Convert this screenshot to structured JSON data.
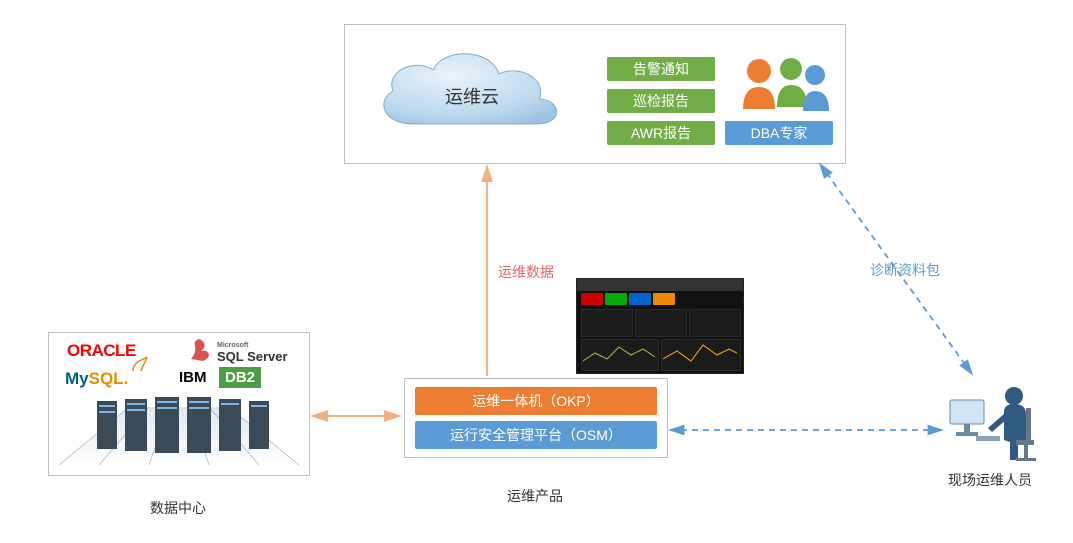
{
  "cloudBox": {
    "cloudLabel": "运维云",
    "pills": {
      "g1": "告警通知",
      "g2": "巡检报告",
      "g3": "AWR报告",
      "b1": "DBA专家"
    }
  },
  "productBox": {
    "label": "运维产品",
    "pill1": "运维一体机（OKP）",
    "pill2": "运行安全管理平台（OSM）"
  },
  "dataCenter": {
    "label": "数据中心",
    "logos": {
      "oracle": "ORACLE",
      "sqlserver_top": "Microsoft",
      "sqlserver": "SQL Server",
      "mysql_pre": "My",
      "mysql_post": "SQL",
      "ibm": "IBM",
      "db2": "DB2"
    }
  },
  "person": {
    "label": "现场运维人员"
  },
  "edgeLabels": {
    "opsData": "运维数据",
    "diagPack": "诊断资料包"
  },
  "colors": {
    "green": "#70ad47",
    "blue": "#5b9bd5",
    "orange": "#ed7d31",
    "arrow_orange": "#f4b183",
    "arrow_blue": "#5b9bd5"
  }
}
